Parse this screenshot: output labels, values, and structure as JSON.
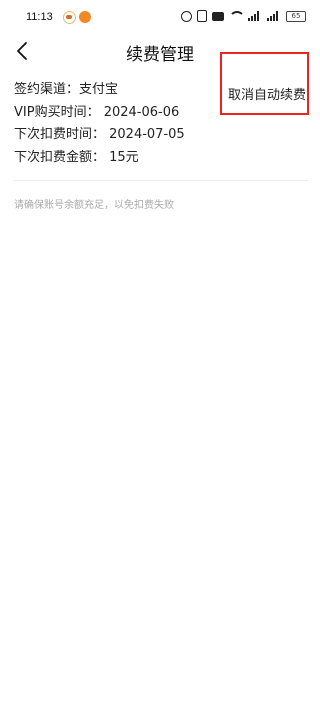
{
  "status_bar": {
    "time": "11:13",
    "battery": "65"
  },
  "header": {
    "title": "续费管理"
  },
  "info": {
    "channel": "签约渠道：支付宝",
    "vip_purchase": "VIP购买时间：  2024-06-06",
    "next_deduct_time": "下次扣费时间：  2024-07-05",
    "next_deduct_amount": "下次扣费金额：  15元"
  },
  "actions": {
    "cancel_auto_renew": "取消自动续费"
  },
  "hint": "请确保账号余额充足，以免扣费失败",
  "colors": {
    "highlight_border": "#e8261f",
    "hint_text": "#aaaaaa"
  }
}
